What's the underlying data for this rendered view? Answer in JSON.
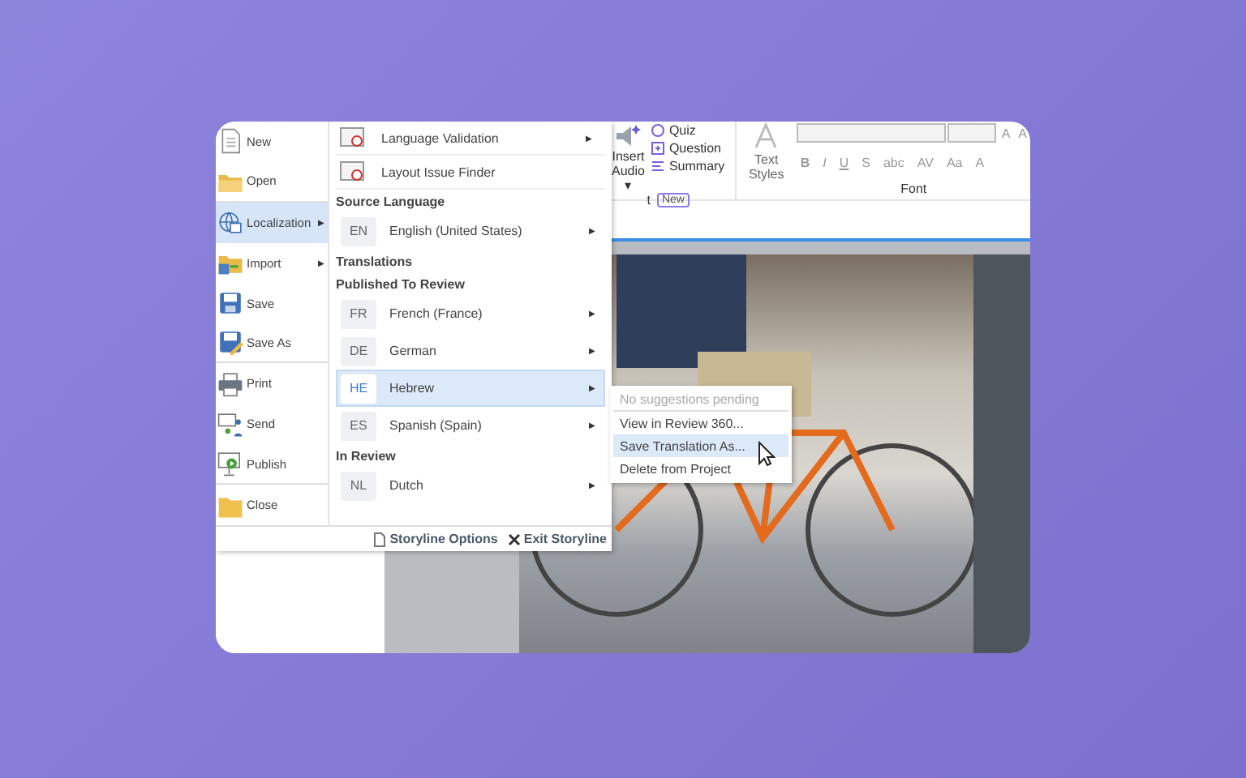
{
  "ribbon": {
    "insert_audio": "Insert Audio",
    "audio_caret": "▾",
    "quick_buttons": [
      {
        "label": "Quiz",
        "kind": "quiz"
      },
      {
        "label": "Question",
        "kind": "question"
      },
      {
        "label": "Summary",
        "kind": "summary"
      }
    ],
    "group_label": "t",
    "new_badge": "New",
    "text_styles": "Text Styles",
    "font_buttons": [
      "B",
      "I",
      "U",
      "S",
      "abc",
      "AV",
      "Aa",
      "A"
    ],
    "font_group": "Font",
    "size_buttons": [
      "A",
      "A"
    ]
  },
  "file_menu": {
    "items": [
      {
        "label": "New",
        "kind": "new",
        "selected": false
      },
      {
        "label": "Open",
        "kind": "open",
        "selected": false
      },
      {
        "label": "Localization",
        "kind": "localization",
        "selected": true,
        "arrow": "▶"
      },
      {
        "label": "Import",
        "kind": "import",
        "selected": false,
        "arrow": "▶"
      },
      {
        "label": "Save",
        "kind": "save",
        "selected": false
      },
      {
        "label": "Save As",
        "kind": "saveas",
        "selected": false
      },
      {
        "label": "Print",
        "kind": "print",
        "selected": false
      },
      {
        "label": "Send",
        "kind": "send",
        "selected": false
      },
      {
        "label": "Publish",
        "kind": "publish",
        "selected": false
      },
      {
        "label": "Close",
        "kind": "close",
        "selected": false
      }
    ]
  },
  "localization_menu": {
    "entries": [
      {
        "kind": "tool",
        "label": "Language Validation",
        "arrow": "▶"
      },
      {
        "kind": "tool",
        "label": "Layout Issue Finder"
      },
      {
        "kind": "section",
        "label": "Source Language"
      },
      {
        "kind": "language",
        "code": "EN",
        "label": "English (United States)",
        "selected": false,
        "arrow": "▶"
      },
      {
        "kind": "section",
        "label": "Translations"
      },
      {
        "kind": "section",
        "label": "Published To Review"
      },
      {
        "kind": "language",
        "code": "FR",
        "label": "French (France)",
        "selected": false,
        "arrow": "▶"
      },
      {
        "kind": "language",
        "code": "DE",
        "label": "German",
        "selected": false,
        "arrow": "▶"
      },
      {
        "kind": "language",
        "code": "HE",
        "label": "Hebrew",
        "selected": true,
        "arrow": "▶"
      },
      {
        "kind": "language",
        "code": "ES",
        "label": "Spanish (Spain)",
        "selected": false,
        "arrow": "▶"
      },
      {
        "kind": "section",
        "label": "In Review"
      },
      {
        "kind": "language",
        "code": "NL",
        "label": "Dutch",
        "selected": false,
        "arrow": "▶"
      }
    ]
  },
  "menu_footer": {
    "storyline_options": "Storyline Options",
    "exit_storyline": "Exit Storyline"
  },
  "context_menu": {
    "items": [
      {
        "label": "No suggestions pending",
        "disabled": true,
        "selected": false
      },
      {
        "label": "View in Review 360...",
        "disabled": false,
        "selected": false
      },
      {
        "label": "Save Translation As...",
        "disabled": false,
        "selected": true
      },
      {
        "label": "Delete from Project",
        "disabled": false,
        "selected": false
      }
    ]
  }
}
